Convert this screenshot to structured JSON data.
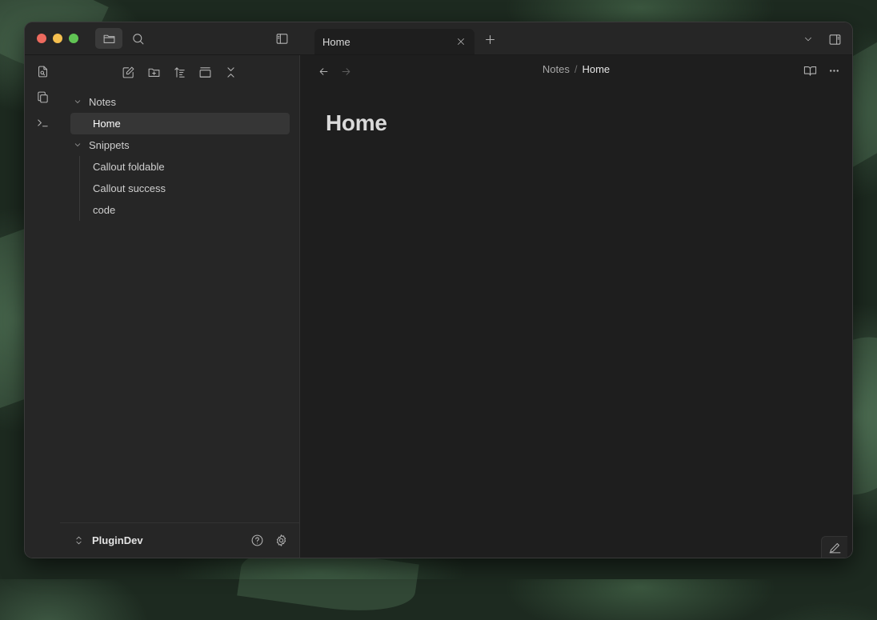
{
  "titlebar": {
    "icons": [
      "folder-icon",
      "search-icon",
      "sidebar-toggle-icon",
      "plus-icon",
      "chevron-down-icon",
      "right-sidebar-icon"
    ]
  },
  "tabs": [
    {
      "label": "Home",
      "active": true
    }
  ],
  "ribbon": {
    "icons": [
      "open-quick-switcher-icon",
      "copy-icon",
      "terminal-icon"
    ]
  },
  "sidebar": {
    "toolbar_icons": [
      "new-note-icon",
      "new-folder-icon",
      "sort-icon",
      "auto-reveal-icon",
      "collapse-all-icon"
    ],
    "tree": [
      {
        "folder": "Notes",
        "expanded": true,
        "files": [
          "Home"
        ]
      },
      {
        "folder": "Snippets",
        "expanded": true,
        "files": [
          "Callout foldable",
          "Callout success",
          "code"
        ]
      }
    ],
    "active_file": "Home",
    "vault_name": "PluginDev"
  },
  "main": {
    "breadcrumb": {
      "parent": "Notes",
      "separator": "/",
      "current": "Home"
    },
    "note_title": "Home"
  },
  "colors": {
    "window_bg": "#1e1e1e",
    "sidebar_bg": "#262626",
    "active_item_bg": "#363636"
  }
}
